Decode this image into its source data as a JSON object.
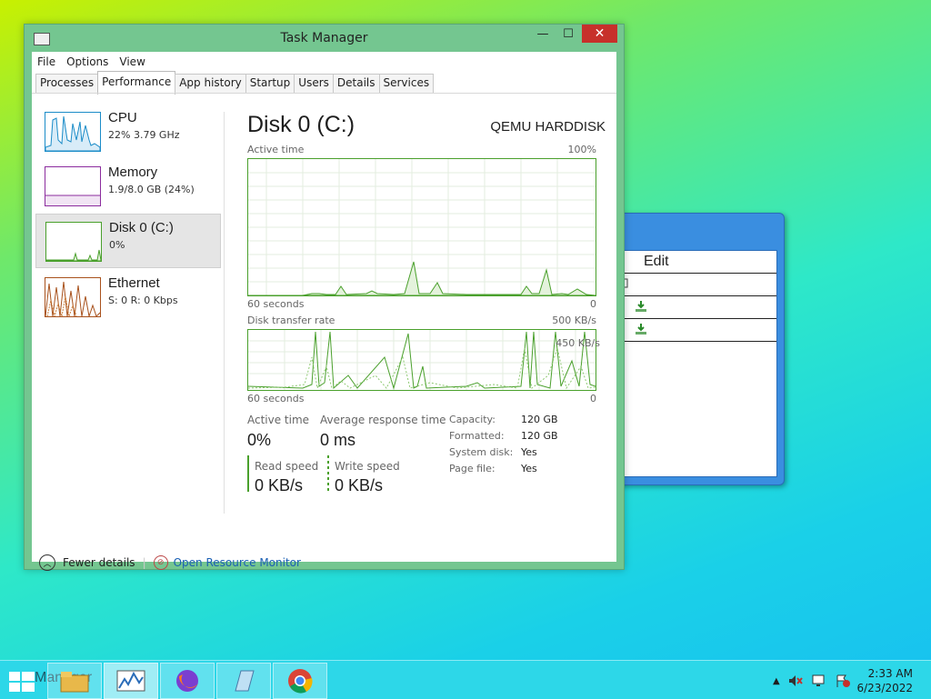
{
  "window": {
    "title": "Task Manager",
    "controls": {
      "minimize": "—",
      "maximize": "☐",
      "close": "✕"
    }
  },
  "menubar": [
    "File",
    "Options",
    "View"
  ],
  "tabs": [
    "Processes",
    "Performance",
    "App history",
    "Startup",
    "Users",
    "Details",
    "Services"
  ],
  "active_tab": "Performance",
  "resources": [
    {
      "name": "CPU",
      "value": "22%  3.79 GHz",
      "color": "#1b8cc8"
    },
    {
      "name": "Memory",
      "value": "1.9/8.0 GB (24%)",
      "color": "#8b2c9e"
    },
    {
      "name": "Disk 0 (C:)",
      "value": "0%",
      "color": "#4aa02c"
    },
    {
      "name": "Ethernet",
      "value": "S: 0  R: 0 Kbps",
      "color": "#a8511c"
    }
  ],
  "selected_resource": "Disk 0 (C:)",
  "main": {
    "title": "Disk 0 (C:)",
    "model": "QEMU HARDDISK",
    "active_graph": {
      "label": "Active time",
      "max": "100%",
      "xlabel": "60 seconds",
      "min": "0"
    },
    "transfer_graph": {
      "label": "Disk transfer rate",
      "max": "500 KB/s",
      "mid": "450 KB/s",
      "xlabel": "60 seconds",
      "min": "0"
    },
    "stats": {
      "active_time_label": "Active time",
      "active_time_value": "0%",
      "avg_resp_label": "Average response time",
      "avg_resp_value": "0 ms",
      "read_label": "Read speed",
      "read_value": "0 KB/s",
      "write_label": "Write speed",
      "write_value": "0 KB/s"
    },
    "details": [
      {
        "key": "Capacity:",
        "value": "120 GB"
      },
      {
        "key": "Formatted:",
        "value": "120 GB"
      },
      {
        "key": "System disk:",
        "value": "Yes"
      },
      {
        "key": "Page file:",
        "value": "Yes"
      }
    ]
  },
  "footer": {
    "fewer_details": "Fewer details",
    "resource_monitor": "Open Resource Monitor"
  },
  "background_window": {
    "menu": "Edit"
  },
  "taskbar": {
    "ghost_label": "Manager",
    "items": [
      "file-explorer-icon",
      "task-manager-icon",
      "firefox-icon",
      "notepad-icon",
      "chrome-icon"
    ],
    "time": "2:33 AM",
    "date": "6/23/2022"
  },
  "colors": {
    "disk_green": "#4aa02c",
    "close_red": "#c7302b",
    "link_blue": "#1a5fb4"
  }
}
